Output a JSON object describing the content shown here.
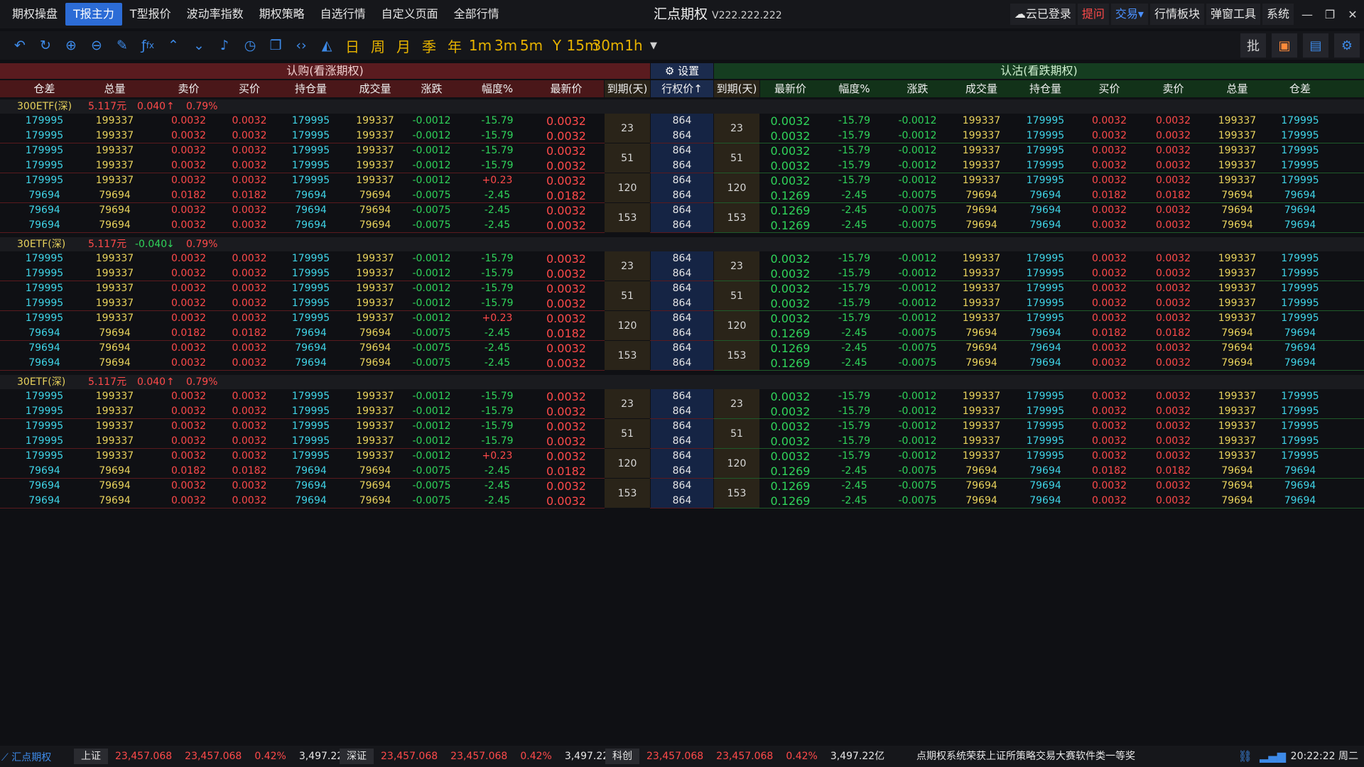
{
  "menubar": {
    "items": [
      "期权操盘",
      "T报主力",
      "T型报价",
      "波动率指数",
      "期权策略",
      "自选行情",
      "自定义页面",
      "全部行情"
    ],
    "active_index": 1,
    "title": "汇点期权",
    "version": "V222.222.222",
    "cloud_login": "云已登录",
    "ask": "提问",
    "trade": "交易",
    "right_items": [
      "行情板块",
      "弹窗工具",
      "系统"
    ]
  },
  "toolbar": {
    "icons": [
      "undo-icon",
      "refresh-icon",
      "zoom-in-icon",
      "zoom-out-icon",
      "draw-line-icon",
      "formula-icon",
      "arrow-up-icon",
      "arrow-down-icon",
      "alert-bell-icon",
      "clock-icon",
      "copy-window-icon",
      "code-icon",
      "area-chart-icon"
    ],
    "formula_label": "fx",
    "periods": [
      "日",
      "周",
      "月",
      "季",
      "年",
      "1m",
      "3m",
      "5m",
      "Y",
      "15m",
      "30m",
      "1h"
    ],
    "right_tools": [
      "批",
      "basket-icon",
      "cash-icon",
      "gear-icon"
    ]
  },
  "header": {
    "call_title": "认购(看涨期权)",
    "setting_label": "设置",
    "put_title": "认沽(看跌期权)",
    "call_columns": [
      "仓差",
      "总量",
      "卖价",
      "买价",
      "持仓量",
      "成交量",
      "涨跌",
      "幅度%",
      "最新价"
    ],
    "expiry_label": "到期(天)",
    "strike_label": "行权价↑",
    "put_columns": [
      "最新价",
      "幅度%",
      "涨跌",
      "成交量",
      "持仓量",
      "买价",
      "卖价",
      "总量",
      "仓差"
    ]
  },
  "groups": [
    {
      "name": "300ETF(深)",
      "price": "5.117元",
      "change": "0.040",
      "direction": "up",
      "pct": "0.79%",
      "expiries": [
        "23",
        "51",
        "120",
        "153"
      ],
      "rows": [
        {
          "call": [
            "179995",
            "199337",
            "0.0032",
            "0.0032",
            "179995",
            "199337",
            "-0.0012",
            "-15.79",
            "0.0032"
          ],
          "strike": "864",
          "put": [
            "0.0032",
            "-15.79",
            "-0.0012",
            "199337",
            "179995",
            "0.0032",
            "0.0032",
            "199337",
            "179995"
          ]
        },
        {
          "call": [
            "179995",
            "199337",
            "0.0032",
            "0.0032",
            "179995",
            "199337",
            "-0.0012",
            "-15.79",
            "0.0032"
          ],
          "strike": "864",
          "put": [
            "0.0032",
            "-15.79",
            "-0.0012",
            "199337",
            "179995",
            "0.0032",
            "0.0032",
            "199337",
            "179995"
          ]
        },
        {
          "call": [
            "179995",
            "199337",
            "0.0032",
            "0.0032",
            "179995",
            "199337",
            "-0.0012",
            "-15.79",
            "0.0032"
          ],
          "strike": "864",
          "put": [
            "0.0032",
            "-15.79",
            "-0.0012",
            "199337",
            "179995",
            "0.0032",
            "0.0032",
            "199337",
            "179995"
          ]
        },
        {
          "call": [
            "179995",
            "199337",
            "0.0032",
            "0.0032",
            "179995",
            "199337",
            "-0.0012",
            "-15.79",
            "0.0032"
          ],
          "strike": "864",
          "put": [
            "0.0032",
            "-15.79",
            "-0.0012",
            "199337",
            "179995",
            "0.0032",
            "0.0032",
            "199337",
            "179995"
          ]
        },
        {
          "call": [
            "179995",
            "199337",
            "0.0032",
            "0.0032",
            "179995",
            "199337",
            "-0.0012",
            "+0.23",
            "0.0032"
          ],
          "strike": "864",
          "put": [
            "0.0032",
            "-15.79",
            "-0.0012",
            "199337",
            "179995",
            "0.0032",
            "0.0032",
            "199337",
            "179995"
          ]
        },
        {
          "call": [
            "79694",
            "79694",
            "0.0182",
            "0.0182",
            "79694",
            "79694",
            "-0.0075",
            "-2.45",
            "0.0182"
          ],
          "strike": "864",
          "put": [
            "0.1269",
            "-2.45",
            "-0.0075",
            "79694",
            "79694",
            "0.0182",
            "0.0182",
            "79694",
            "79694"
          ]
        },
        {
          "call": [
            "79694",
            "79694",
            "0.0032",
            "0.0032",
            "79694",
            "79694",
            "-0.0075",
            "-2.45",
            "0.0032"
          ],
          "strike": "864",
          "put": [
            "0.1269",
            "-2.45",
            "-0.0075",
            "79694",
            "79694",
            "0.0032",
            "0.0032",
            "79694",
            "79694"
          ]
        },
        {
          "call": [
            "79694",
            "79694",
            "0.0032",
            "0.0032",
            "79694",
            "79694",
            "-0.0075",
            "-2.45",
            "0.0032"
          ],
          "strike": "864",
          "put": [
            "0.1269",
            "-2.45",
            "-0.0075",
            "79694",
            "79694",
            "0.0032",
            "0.0032",
            "79694",
            "79694"
          ]
        }
      ]
    },
    {
      "name": "30ETF(深)",
      "price": "5.117元",
      "change": "-0.040",
      "direction": "down",
      "pct": "0.79%",
      "expiries": [
        "23",
        "51",
        "120",
        "153"
      ],
      "rows": [
        {
          "call": [
            "179995",
            "199337",
            "0.0032",
            "0.0032",
            "179995",
            "199337",
            "-0.0012",
            "-15.79",
            "0.0032"
          ],
          "strike": "864",
          "put": [
            "0.0032",
            "-15.79",
            "-0.0012",
            "199337",
            "179995",
            "0.0032",
            "0.0032",
            "199337",
            "179995"
          ]
        },
        {
          "call": [
            "179995",
            "199337",
            "0.0032",
            "0.0032",
            "179995",
            "199337",
            "-0.0012",
            "-15.79",
            "0.0032"
          ],
          "strike": "864",
          "put": [
            "0.0032",
            "-15.79",
            "-0.0012",
            "199337",
            "179995",
            "0.0032",
            "0.0032",
            "199337",
            "179995"
          ]
        },
        {
          "call": [
            "179995",
            "199337",
            "0.0032",
            "0.0032",
            "179995",
            "199337",
            "-0.0012",
            "-15.79",
            "0.0032"
          ],
          "strike": "864",
          "put": [
            "0.0032",
            "-15.79",
            "-0.0012",
            "199337",
            "179995",
            "0.0032",
            "0.0032",
            "199337",
            "179995"
          ]
        },
        {
          "call": [
            "179995",
            "199337",
            "0.0032",
            "0.0032",
            "179995",
            "199337",
            "-0.0012",
            "-15.79",
            "0.0032"
          ],
          "strike": "864",
          "put": [
            "0.0032",
            "-15.79",
            "-0.0012",
            "199337",
            "179995",
            "0.0032",
            "0.0032",
            "199337",
            "179995"
          ]
        },
        {
          "call": [
            "179995",
            "199337",
            "0.0032",
            "0.0032",
            "179995",
            "199337",
            "-0.0012",
            "+0.23",
            "0.0032"
          ],
          "strike": "864",
          "put": [
            "0.0032",
            "-15.79",
            "-0.0012",
            "199337",
            "179995",
            "0.0032",
            "0.0032",
            "199337",
            "179995"
          ]
        },
        {
          "call": [
            "79694",
            "79694",
            "0.0182",
            "0.0182",
            "79694",
            "79694",
            "-0.0075",
            "-2.45",
            "0.0182"
          ],
          "strike": "864",
          "put": [
            "0.1269",
            "-2.45",
            "-0.0075",
            "79694",
            "79694",
            "0.0182",
            "0.0182",
            "79694",
            "79694"
          ]
        },
        {
          "call": [
            "79694",
            "79694",
            "0.0032",
            "0.0032",
            "79694",
            "79694",
            "-0.0075",
            "-2.45",
            "0.0032"
          ],
          "strike": "864",
          "put": [
            "0.1269",
            "-2.45",
            "-0.0075",
            "79694",
            "79694",
            "0.0032",
            "0.0032",
            "79694",
            "79694"
          ]
        },
        {
          "call": [
            "79694",
            "79694",
            "0.0032",
            "0.0032",
            "79694",
            "79694",
            "-0.0075",
            "-2.45",
            "0.0032"
          ],
          "strike": "864",
          "put": [
            "0.1269",
            "-2.45",
            "-0.0075",
            "79694",
            "79694",
            "0.0032",
            "0.0032",
            "79694",
            "79694"
          ]
        }
      ]
    },
    {
      "name": "30ETF(深)",
      "price": "5.117元",
      "change": "0.040",
      "direction": "up",
      "pct": "0.79%",
      "expiries": [
        "23",
        "51",
        "120",
        "153"
      ],
      "rows": [
        {
          "call": [
            "179995",
            "199337",
            "0.0032",
            "0.0032",
            "179995",
            "199337",
            "-0.0012",
            "-15.79",
            "0.0032"
          ],
          "strike": "864",
          "put": [
            "0.0032",
            "-15.79",
            "-0.0012",
            "199337",
            "179995",
            "0.0032",
            "0.0032",
            "199337",
            "179995"
          ]
        },
        {
          "call": [
            "179995",
            "199337",
            "0.0032",
            "0.0032",
            "179995",
            "199337",
            "-0.0012",
            "-15.79",
            "0.0032"
          ],
          "strike": "864",
          "put": [
            "0.0032",
            "-15.79",
            "-0.0012",
            "199337",
            "179995",
            "0.0032",
            "0.0032",
            "199337",
            "179995"
          ]
        },
        {
          "call": [
            "179995",
            "199337",
            "0.0032",
            "0.0032",
            "179995",
            "199337",
            "-0.0012",
            "-15.79",
            "0.0032"
          ],
          "strike": "864",
          "put": [
            "0.0032",
            "-15.79",
            "-0.0012",
            "199337",
            "179995",
            "0.0032",
            "0.0032",
            "199337",
            "179995"
          ]
        },
        {
          "call": [
            "179995",
            "199337",
            "0.0032",
            "0.0032",
            "179995",
            "199337",
            "-0.0012",
            "-15.79",
            "0.0032"
          ],
          "strike": "864",
          "put": [
            "0.0032",
            "-15.79",
            "-0.0012",
            "199337",
            "179995",
            "0.0032",
            "0.0032",
            "199337",
            "179995"
          ]
        },
        {
          "call": [
            "179995",
            "199337",
            "0.0032",
            "0.0032",
            "179995",
            "199337",
            "-0.0012",
            "+0.23",
            "0.0032"
          ],
          "strike": "864",
          "put": [
            "0.0032",
            "-15.79",
            "-0.0012",
            "199337",
            "179995",
            "0.0032",
            "0.0032",
            "199337",
            "179995"
          ]
        },
        {
          "call": [
            "79694",
            "79694",
            "0.0182",
            "0.0182",
            "79694",
            "79694",
            "-0.0075",
            "-2.45",
            "0.0182"
          ],
          "strike": "864",
          "put": [
            "0.1269",
            "-2.45",
            "-0.0075",
            "79694",
            "79694",
            "0.0182",
            "0.0182",
            "79694",
            "79694"
          ]
        },
        {
          "call": [
            "79694",
            "79694",
            "0.0032",
            "0.0032",
            "79694",
            "79694",
            "-0.0075",
            "-2.45",
            "0.0032"
          ],
          "strike": "864",
          "put": [
            "0.1269",
            "-2.45",
            "-0.0075",
            "79694",
            "79694",
            "0.0032",
            "0.0032",
            "79694",
            "79694"
          ]
        },
        {
          "call": [
            "79694",
            "79694",
            "0.0032",
            "0.0032",
            "79694",
            "79694",
            "-0.0075",
            "-2.45",
            "0.0032"
          ],
          "strike": "864",
          "put": [
            "0.1269",
            "-2.45",
            "-0.0075",
            "79694",
            "79694",
            "0.0032",
            "0.0032",
            "79694",
            "79694"
          ]
        }
      ]
    }
  ],
  "statusbar": {
    "logo": "汇点期权",
    "indices": [
      {
        "name": "上证",
        "v1": "23,457.068",
        "v2": "23,457.068",
        "pct": "0.42%",
        "amount": "3,497.22亿"
      },
      {
        "name": "深证",
        "v1": "23,457.068",
        "v2": "23,457.068",
        "pct": "0.42%",
        "amount": "3,497.22亿"
      },
      {
        "name": "科创",
        "v1": "23,457.068",
        "v2": "23,457.068",
        "pct": "0.42%",
        "amount": "3,497.22亿"
      }
    ],
    "ticker": "点期权系统荣获上证所策略交易大赛软件类一等奖",
    "time": "20:22:22",
    "weekday": "周二"
  },
  "colors": {
    "accent_blue": "#2c6cd6",
    "up_red": "#ff4a4a",
    "down_green": "#2fd45a",
    "volume_cyan": "#3fd3e6",
    "period_yellow": "#e6b200",
    "call_header_bg": "#5a1b1f",
    "put_header_bg": "#153d20"
  }
}
